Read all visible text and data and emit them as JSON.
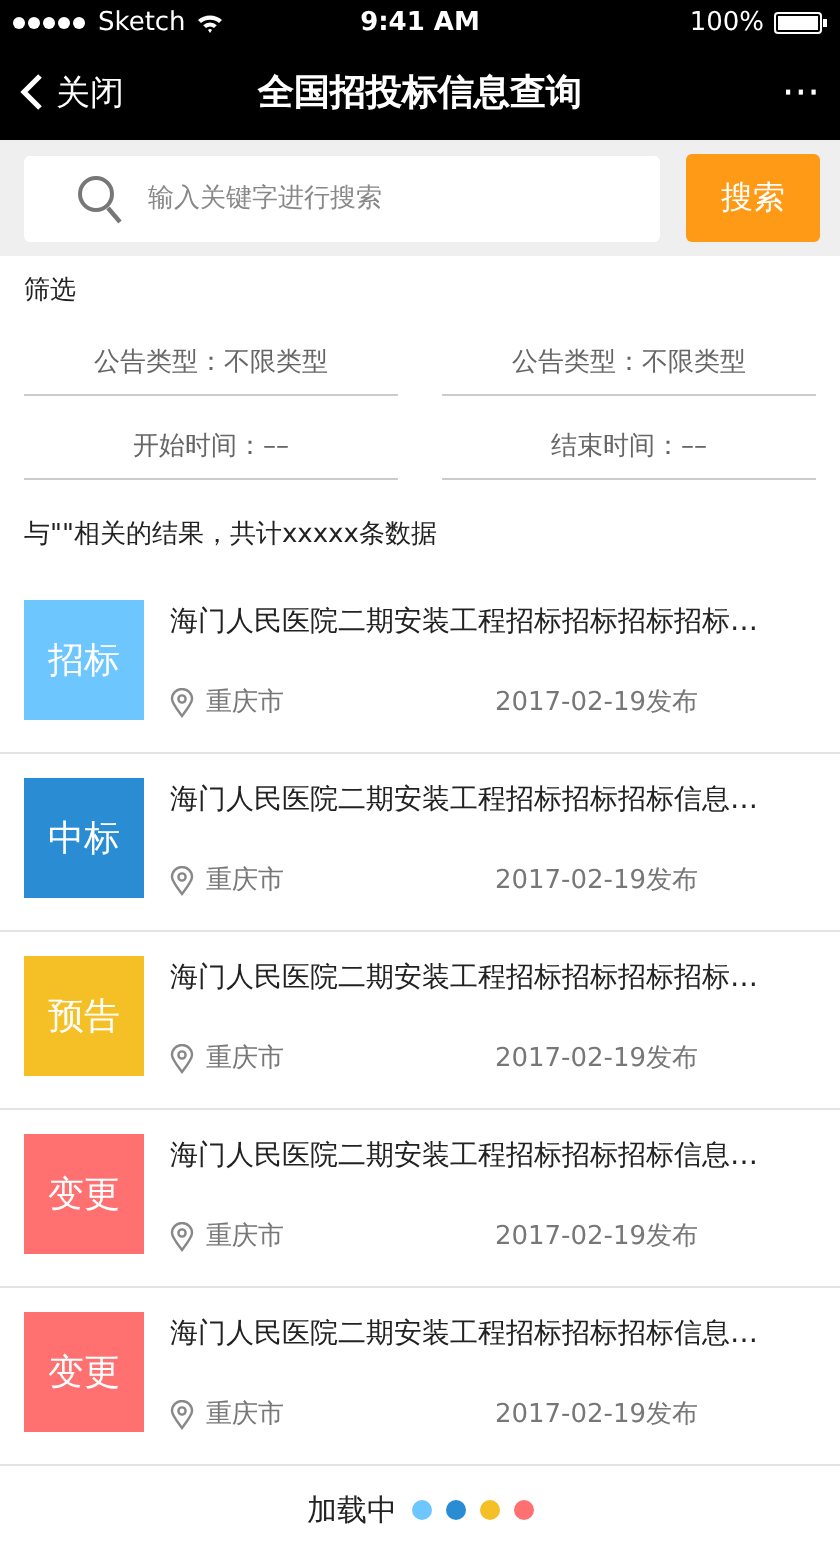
{
  "status_bar": {
    "carrier": "Sketch",
    "time": "9:41 AM",
    "battery": "100%"
  },
  "nav": {
    "back": "关闭",
    "title": "全国招投标信息查询",
    "more": "···"
  },
  "search": {
    "placeholder": "输入关键字进行搜索",
    "button": "搜索"
  },
  "filter": {
    "label": "筛选",
    "fields": [
      {
        "label": "公告类型：不限类型"
      },
      {
        "label": "公告类型：不限类型"
      },
      {
        "label": "开始时间：––"
      },
      {
        "label": "结束时间：––"
      }
    ]
  },
  "result_summary": "与\"\"相关的结果，共计xxxxx条数据",
  "items": [
    {
      "tag": "招标",
      "color": "#6ec6ff",
      "title": "海门人民医院二期安装工程招标招标招标招标…",
      "location": "重庆市",
      "date": "2017-02-19发布"
    },
    {
      "tag": "中标",
      "color": "#2a8dd4",
      "title": "海门人民医院二期安装工程招标招标招标信息…",
      "location": "重庆市",
      "date": "2017-02-19发布"
    },
    {
      "tag": "预告",
      "color": "#f5c026",
      "title": "海门人民医院二期安装工程招标招标招标招标…",
      "location": "重庆市",
      "date": "2017-02-19发布"
    },
    {
      "tag": "变更",
      "color": "#ff7070",
      "title": "海门人民医院二期安装工程招标招标招标信息…",
      "location": "重庆市",
      "date": "2017-02-19发布"
    },
    {
      "tag": "变更",
      "color": "#ff7070",
      "title": "海门人民医院二期安装工程招标招标招标信息…",
      "location": "重庆市",
      "date": "2017-02-19发布"
    }
  ],
  "loading": {
    "label": "加载中",
    "dots": [
      {
        "color": "#6ec6ff"
      },
      {
        "color": "#2a8dd4"
      },
      {
        "color": "#f5c026"
      },
      {
        "color": "#ff7070"
      }
    ]
  }
}
